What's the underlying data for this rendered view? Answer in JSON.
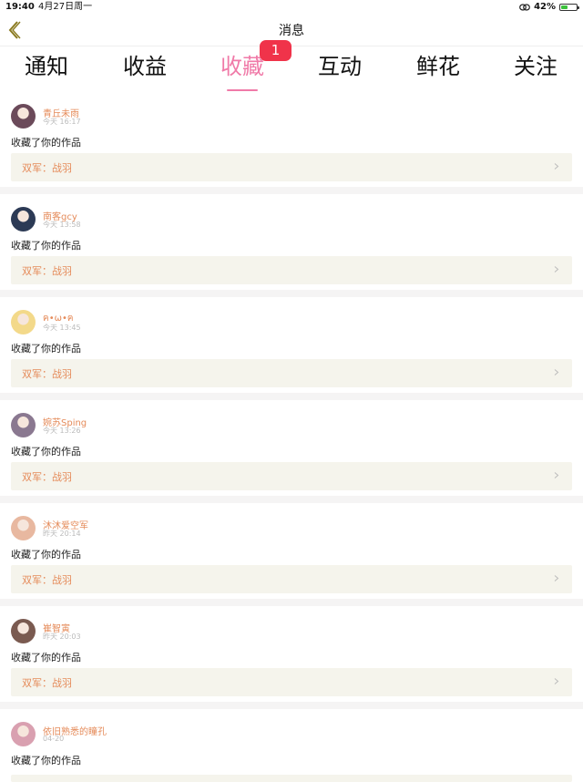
{
  "status_bar": {
    "time": "19:40",
    "date": "4月27日周一",
    "battery_pct": "42%",
    "battery_level": 0.42
  },
  "navbar": {
    "title": "消息"
  },
  "tabs": [
    {
      "label": "通知"
    },
    {
      "label": "收益"
    },
    {
      "label": "收藏",
      "active": true
    },
    {
      "label": "互动"
    },
    {
      "label": "鲜花"
    },
    {
      "label": "关注"
    }
  ],
  "badge": {
    "count": "1"
  },
  "messages": [
    {
      "user": "青丘未雨",
      "time": "今天 16:17",
      "action": "收藏了你的作品",
      "work": "双军：战羽",
      "avatar_color": "#6b4a5a"
    },
    {
      "user": "南客gcy",
      "time": "今天 13:58",
      "action": "收藏了你的作品",
      "work": "双军：战羽",
      "avatar_color": "#2c3a55"
    },
    {
      "user": "ฅ•ω•ฅ",
      "time": "今天 13:45",
      "action": "收藏了你的作品",
      "work": "双军：战羽",
      "avatar_color": "#f3d98a"
    },
    {
      "user": "婉苏Sping",
      "time": "今天 13:26",
      "action": "收藏了你的作品",
      "work": "双军：战羽",
      "avatar_color": "#8a7890"
    },
    {
      "user": "沐沐爱空军",
      "time": "昨天 20:14",
      "action": "收藏了你的作品",
      "work": "双军：战羽",
      "avatar_color": "#e8b8a0"
    },
    {
      "user": "崔智寅",
      "time": "昨天 20:03",
      "action": "收藏了你的作品",
      "work": "双军：战羽",
      "avatar_color": "#7a5a50"
    },
    {
      "user": "依旧熟悉的瞳孔",
      "time": "04-20",
      "action": "收藏了你的作品",
      "work": "",
      "avatar_color": "#d9a0b0"
    }
  ],
  "colors": {
    "accent_pink": "#f07aa8",
    "badge_red": "#f0334a",
    "username_orange": "#e58b5a",
    "work_bg": "#f5f4ec"
  }
}
